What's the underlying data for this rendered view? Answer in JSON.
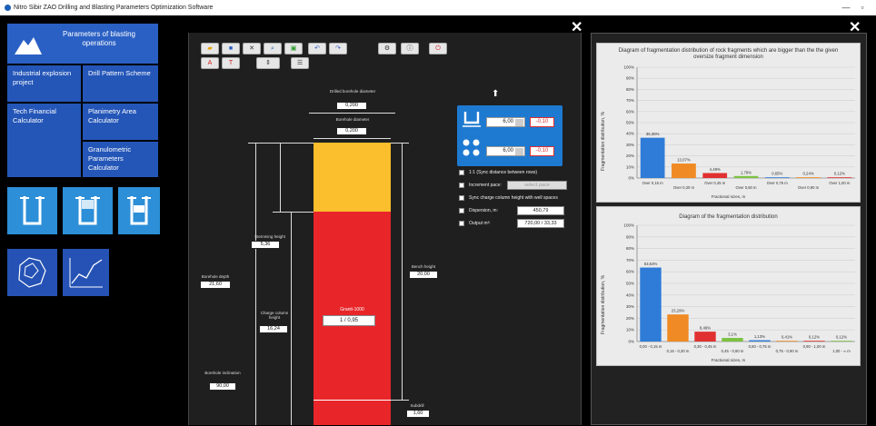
{
  "window": {
    "title": "Nitro Sibir ZAO Drilling and Blasting Parameters Optimization Software",
    "min_label": "—",
    "max_label": "▫"
  },
  "menu": {
    "header": "Parameters of blasting operations",
    "items": [
      {
        "label": "Industrial explosion project"
      },
      {
        "label": "Drill Pattern Scheme"
      },
      {
        "label": "Tech Financial Calculator"
      },
      {
        "label": "Planimetry Area Calculator"
      },
      {
        "label": "Granulometric Parameters Calculator"
      }
    ]
  },
  "center": {
    "close_label": "✕",
    "drilled_diameter_label": "Drilled borehole diameter",
    "drilled_diameter_value": "0,200",
    "borehole_diameter_label": "Borehole diameter",
    "borehole_diameter_value": "0,200",
    "stemming_height_label": "Stemming height",
    "stemming_height_value": "5,36",
    "borehole_depth_label": "Borehole depth",
    "borehole_depth_value": "21,60",
    "charge_height_label": "Charge column height",
    "charge_height_value": "16,24",
    "bench_height_label": "Bench height",
    "bench_height_value": "20,00",
    "inclination_label": "Borehole inclination",
    "inclination_value": "90,00",
    "subdrill_label": "Subdrill",
    "subdrill_value": "1,60",
    "charge_name": "Granit-1000",
    "fraction_value": "1 / 0,95",
    "spin1_value": "6,00",
    "spin1_delta": "-0,10",
    "spin2_value": "6,00",
    "spin2_delta": "-0,10",
    "opt1": "1:1 (Sync distance between rows)",
    "opt2": "Increment pace:",
    "opt2_value": "select pace",
    "opt3": "Sync charge column height with well spaces",
    "opt4": "Dispersion, m:",
    "opt4_value": "450,79",
    "opt5": "Output m³:",
    "opt5_value": "720,00 / 33,33"
  },
  "right": {
    "close_label": "✕",
    "chart1_title": "Diagram of fragmentation distribution of rock fragments which are bigger than the the given oversize fragment dimension",
    "chart2_title": "Diagram of the fragmentation distribution",
    "ylabel": "Fragmentation distribution, %",
    "xlabel": "Fractional sizes, m"
  },
  "chart_data": [
    {
      "type": "bar",
      "title": "Diagram of fragmentation distribution of rock fragments which are bigger than the the given oversize fragment dimension",
      "xlabel": "Fractional sizes, m",
      "ylabel": "Fragmentation distribution, %",
      "ylim": [
        0,
        100
      ],
      "yticks": [
        "0%",
        "10%",
        "20%",
        "30%",
        "40%",
        "50%",
        "60%",
        "70%",
        "80%",
        "90%",
        "100%"
      ],
      "categories": [
        "Over 0,15 m",
        "Over 0,30 m",
        "Over 0,45 m",
        "Over 0,60 m",
        "Over 0,75 m",
        "Over 0,90 m",
        "Over 1,00 m"
      ],
      "values": [
        36.36,
        13.07,
        4.49,
        1.79,
        0.65,
        0.24,
        0.12
      ],
      "labels": [
        "36,36%",
        "13,07%",
        "4,49%",
        "1,79%",
        "0,65%",
        "0,24%",
        "0,12%"
      ],
      "colors": [
        "#2f7cd8",
        "#f08a24",
        "#e03030",
        "#7cc242",
        "#2f7cd8",
        "#f08a24",
        "#e03030"
      ]
    },
    {
      "type": "bar",
      "title": "Diagram of the fragmentation distribution",
      "xlabel": "Fractional sizes, m",
      "ylabel": "Fragmentation distribution, %",
      "ylim": [
        0,
        100
      ],
      "yticks": [
        "0%",
        "10%",
        "20%",
        "30%",
        "40%",
        "50%",
        "60%",
        "70%",
        "80%",
        "90%",
        "100%"
      ],
      "categories": [
        "0,00 - 0,15 m",
        "0,15 - 0,30 m",
        "0,30 - 0,45 m",
        "0,45 - 0,60 m",
        "0,60 - 0,75 m",
        "0,75 - 0,90 m",
        "0,90 - 1,00 m",
        "1,00 - ∞ m"
      ],
      "values": [
        63.63,
        23.29,
        8.49,
        3.1,
        1.13,
        0.41,
        0.12,
        0.12
      ],
      "labels": [
        "63,63%",
        "23,29%",
        "8,49%",
        "3,1%",
        "1,13%",
        "0,41%",
        "0,12%",
        "0,12%"
      ],
      "colors": [
        "#2f7cd8",
        "#f08a24",
        "#e03030",
        "#7cc242",
        "#2f7cd8",
        "#f08a24",
        "#e03030",
        "#7cc242"
      ]
    }
  ]
}
